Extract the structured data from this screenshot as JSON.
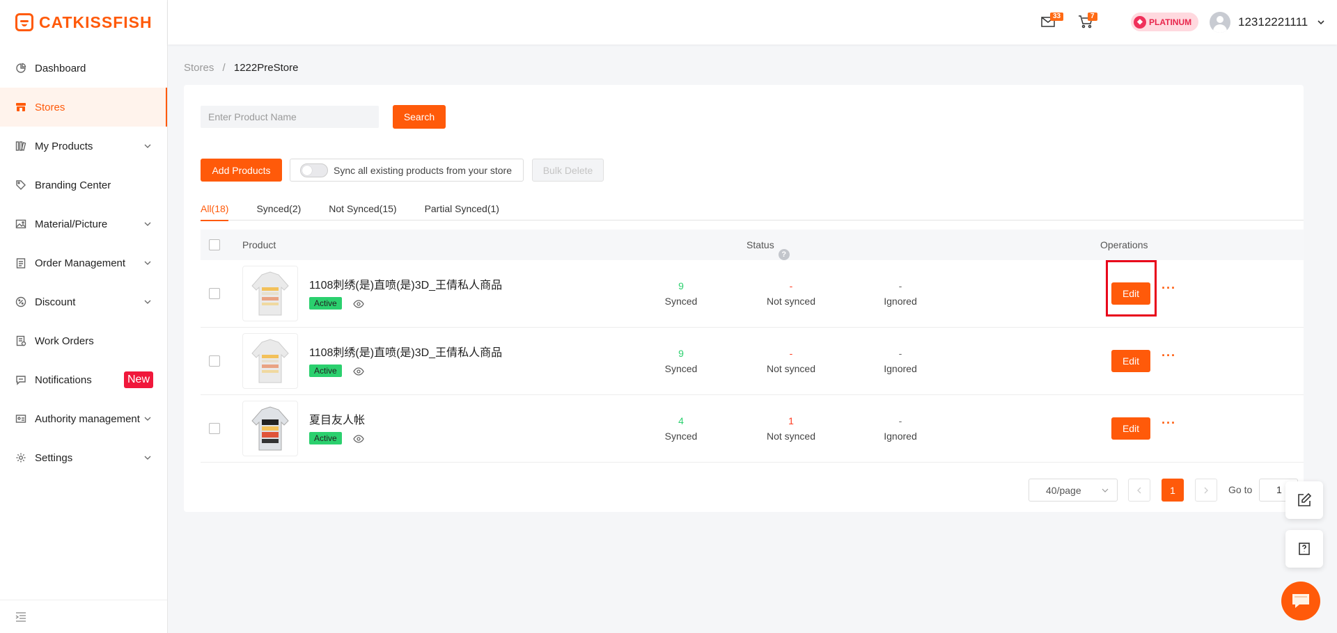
{
  "brand": {
    "name": "CATKISSFISH"
  },
  "sidebar": {
    "items": [
      {
        "label": "Dashboard",
        "icon": "pie-chart-icon"
      },
      {
        "label": "Stores",
        "icon": "store-icon"
      },
      {
        "label": "My Products",
        "icon": "products-icon"
      },
      {
        "label": "Branding Center",
        "icon": "tag-icon"
      },
      {
        "label": "Material/Picture",
        "icon": "image-icon"
      },
      {
        "label": "Order Management",
        "icon": "clipboard-icon"
      },
      {
        "label": "Discount",
        "icon": "discount-icon"
      },
      {
        "label": "Work Orders",
        "icon": "work-order-icon"
      },
      {
        "label": "Notifications",
        "icon": "message-icon",
        "badge": "New"
      },
      {
        "label": "Authority management",
        "icon": "id-card-icon"
      },
      {
        "label": "Settings",
        "icon": "gear-icon"
      }
    ]
  },
  "header": {
    "mail_count": "33",
    "cart_count": "7",
    "membership": "PLATINUM",
    "username": "12312221111"
  },
  "breadcrumb": {
    "parent": "Stores",
    "sep": "/",
    "current": "1222PreStore"
  },
  "toolbar": {
    "search_placeholder": "Enter Product Name",
    "search_label": "Search",
    "add_label": "Add Products",
    "sync_label": "Sync all existing products from your store",
    "bulk_delete_label": "Bulk Delete"
  },
  "tabs": [
    {
      "label": "All(18)"
    },
    {
      "label": "Synced(2)"
    },
    {
      "label": "Not Synced(15)"
    },
    {
      "label": "Partial Synced(1)"
    }
  ],
  "table": {
    "headers": {
      "product": "Product",
      "status": "Status",
      "operations": "Operations"
    },
    "status_help": "?",
    "rows": [
      {
        "name": "1108刺绣(是)直喷(是)3D_王倩私人商品",
        "status": "Active",
        "synced": "9",
        "synced_label": "Synced",
        "not_synced": "-",
        "not_synced_label": "Not synced",
        "ignored": "-",
        "ignored_label": "Ignored",
        "edit": "Edit",
        "more": "···"
      },
      {
        "name": "1108刺绣(是)直喷(是)3D_王倩私人商品",
        "status": "Active",
        "synced": "9",
        "synced_label": "Synced",
        "not_synced": "-",
        "not_synced_label": "Not synced",
        "ignored": "-",
        "ignored_label": "Ignored",
        "edit": "Edit",
        "more": "···"
      },
      {
        "name": "夏目友人帐",
        "status": "Active",
        "synced": "4",
        "synced_label": "Synced",
        "not_synced": "1",
        "not_synced_label": "Not synced",
        "ignored": "-",
        "ignored_label": "Ignored",
        "edit": "Edit",
        "more": "···"
      }
    ]
  },
  "pagination": {
    "page_size": "40/page",
    "current_page": "1",
    "goto_label": "Go to",
    "goto_value": "1"
  },
  "colors": {
    "accent": "#ff5a0a",
    "synced": "#2bd06e",
    "not_synced": "#ff3b1f",
    "active_badge": "#2bd06e",
    "highlight": "#e8001a"
  }
}
